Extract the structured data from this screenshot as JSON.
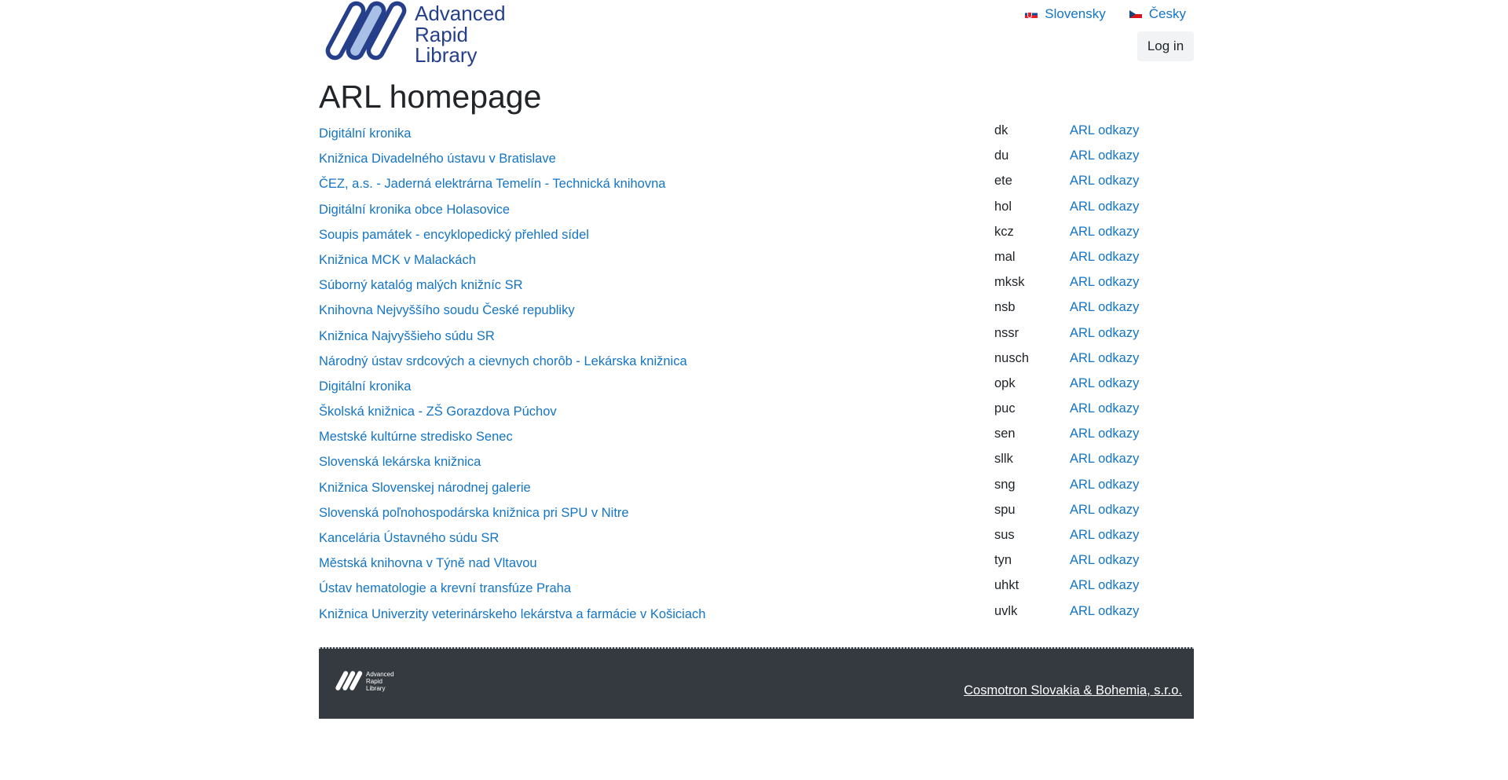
{
  "brand": {
    "logo_lines": [
      "Advanced",
      "Rapid",
      "Library"
    ],
    "logo_color": "#253f8a",
    "logo_accent_color": "#a9c0e6"
  },
  "header": {
    "languages": [
      {
        "label": "Slovensky",
        "flag_icon": "slovak-flag-icon"
      },
      {
        "label": "Česky",
        "flag_icon": "czech-flag-icon"
      }
    ],
    "login_label": "Log in"
  },
  "page_title": "ARL homepage",
  "link_color": "#1475c5",
  "libraries": [
    {
      "name": "Digitální kronika",
      "code": "dk",
      "link": "ARL odkazy"
    },
    {
      "name": "Knižnica Divadelného ústavu v Bratislave",
      "code": "du",
      "link": "ARL odkazy"
    },
    {
      "name": "ČEZ, a.s. - Jaderná elektrárna Temelín - Technická knihovna",
      "code": "ete",
      "link": "ARL odkazy"
    },
    {
      "name": "Digitální kronika obce Holasovice",
      "code": "hol",
      "link": "ARL odkazy"
    },
    {
      "name": "Soupis památek - encyklopedický přehled sídel",
      "code": "kcz",
      "link": "ARL odkazy"
    },
    {
      "name": "Knižnica MCK v Malackách",
      "code": "mal",
      "link": "ARL odkazy"
    },
    {
      "name": "Súborný katalóg malých knižníc SR",
      "code": "mksk",
      "link": "ARL odkazy"
    },
    {
      "name": "Knihovna Nejvyššího soudu České republiky",
      "code": "nsb",
      "link": "ARL odkazy"
    },
    {
      "name": "Knižnica Najvyššieho súdu SR",
      "code": "nssr",
      "link": "ARL odkazy"
    },
    {
      "name": "Národný ústav srdcových a cievnych chorôb - Lekárska knižnica",
      "code": "nusch",
      "link": "ARL odkazy"
    },
    {
      "name": "Digitální kronika",
      "code": "opk",
      "link": "ARL odkazy"
    },
    {
      "name": "Školská knižnica - ZŠ Gorazdova Púchov",
      "code": "puc",
      "link": "ARL odkazy"
    },
    {
      "name": "Mestské kultúrne stredisko Senec",
      "code": "sen",
      "link": "ARL odkazy"
    },
    {
      "name": "Slovenská lekárska knižnica",
      "code": "sllk",
      "link": "ARL odkazy"
    },
    {
      "name": "Knižnica Slovenskej národnej galerie",
      "code": "sng",
      "link": "ARL odkazy"
    },
    {
      "name": "Slovenská poľnohospodárska knižnica pri SPU v Nitre",
      "code": "spu",
      "link": "ARL odkazy"
    },
    {
      "name": "Kancelária Ústavného súdu SR",
      "code": "sus",
      "link": "ARL odkazy"
    },
    {
      "name": "Městská knihovna v Týně nad Vltavou",
      "code": "tyn",
      "link": "ARL odkazy"
    },
    {
      "name": "Ústav hematologie a krevní transfúze Praha",
      "code": "uhkt",
      "link": "ARL odkazy"
    },
    {
      "name": "Knižnica Univerzity veterinárskeho lekárstva a farmácie v Košiciach",
      "code": "uvlk",
      "link": "ARL odkazy"
    }
  ],
  "footer": {
    "logo_lines": [
      "Advanced",
      "Rapid",
      "Library"
    ],
    "company_link": "Cosmotron Slovakia & Bohemia, s.r.o.",
    "background": "#343a40"
  }
}
